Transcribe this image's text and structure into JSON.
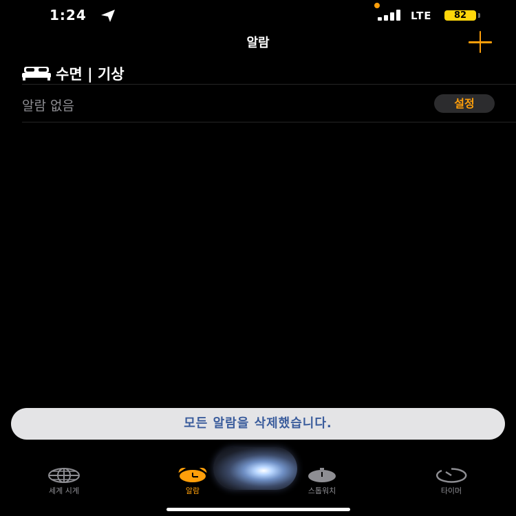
{
  "status_bar": {
    "time": "1:24",
    "network": "LTE",
    "battery": "82"
  },
  "nav": {
    "title": "알람"
  },
  "sleep_section": {
    "title": "수면 | 기상",
    "no_alarm_text": "알람 없음",
    "setup_label": "설정"
  },
  "siri": {
    "message": "모든 알람을 삭제했습니다."
  },
  "tabs": [
    {
      "label": "세계 시계",
      "icon": "globe-icon"
    },
    {
      "label": "알람",
      "icon": "alarm-clock-icon",
      "active": true
    },
    {
      "label": "스톱워치",
      "icon": "stopwatch-icon"
    },
    {
      "label": "타이머",
      "icon": "timer-icon"
    }
  ],
  "colors": {
    "accent": "#ff9f0a",
    "background": "#000000",
    "secondary_text": "#8e8e93",
    "battery": "#ffd60a"
  }
}
